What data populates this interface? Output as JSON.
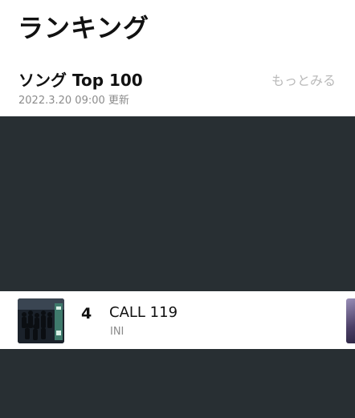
{
  "header": {
    "title": "ランキング"
  },
  "section": {
    "title": "ソング Top 100",
    "more_label": "もっとみる",
    "updated": "2022.3.20 09:00 更新"
  },
  "songs": [
    {
      "rank": "4",
      "title": "CALL 119",
      "artist": "INI"
    }
  ]
}
